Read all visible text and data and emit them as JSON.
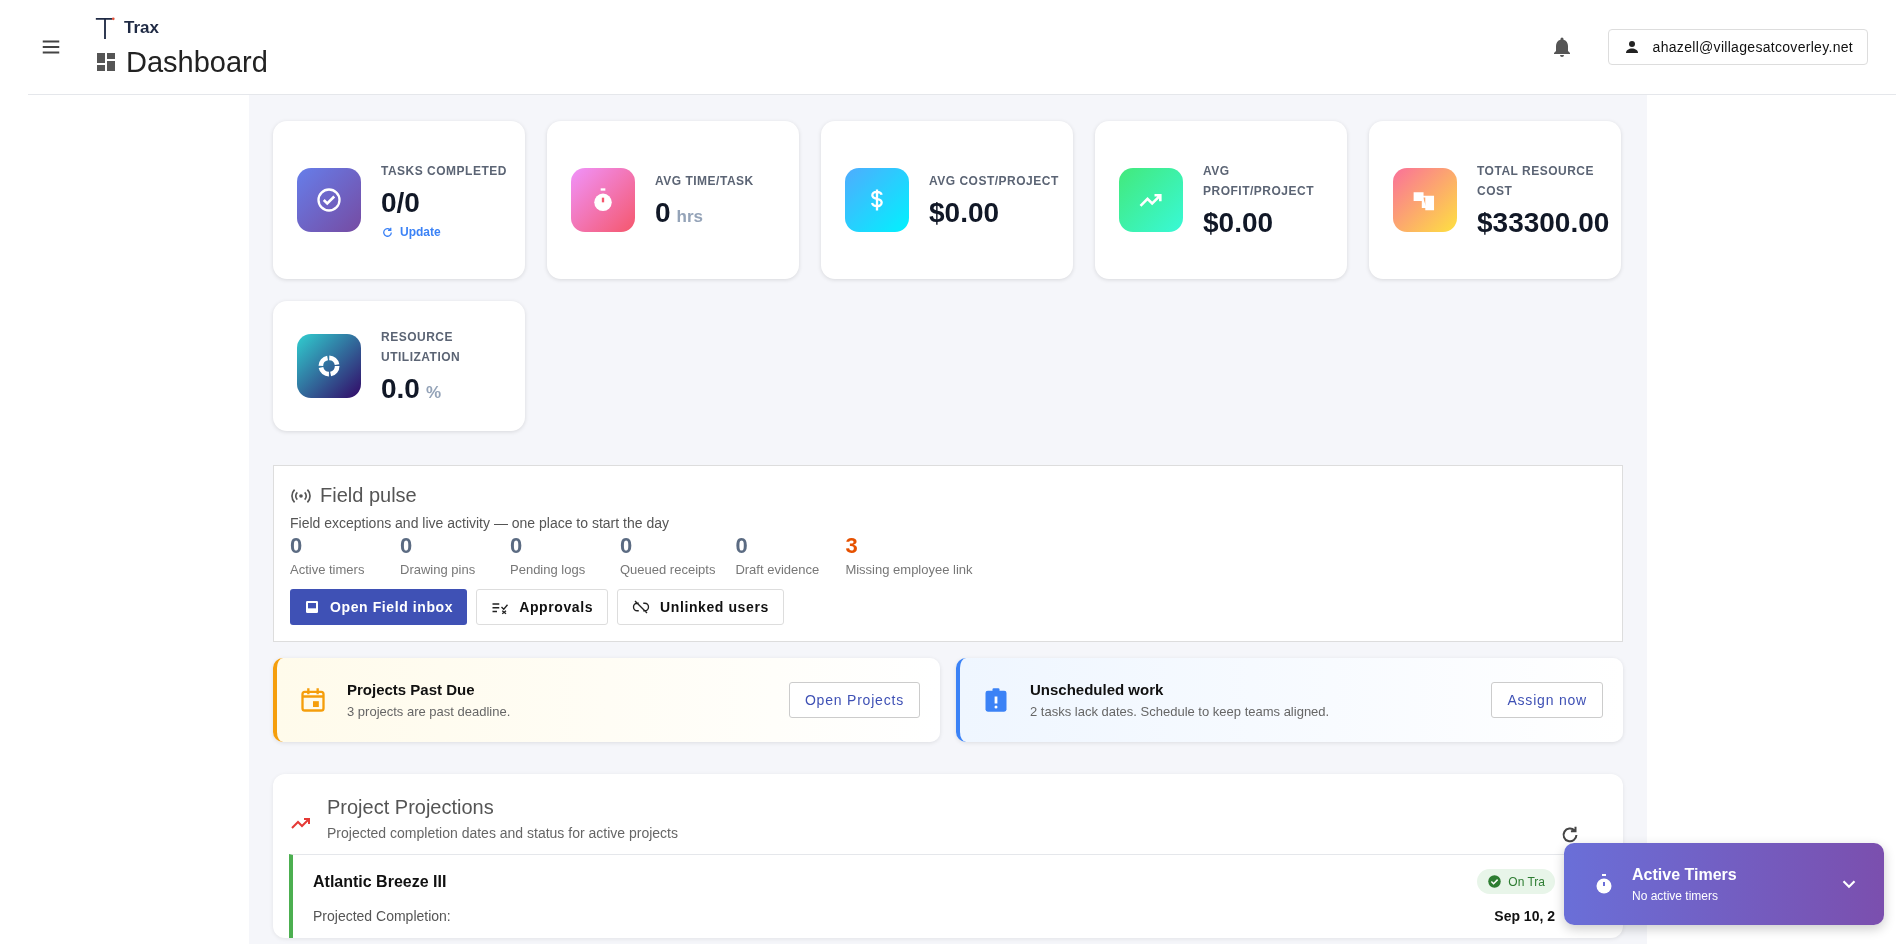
{
  "header": {
    "brand": "Trax",
    "title": "Dashboard",
    "user": "ahazell@villagesatcoverley.net"
  },
  "stat_cards": [
    {
      "kind": "check",
      "label": "TASKS COMPLETED",
      "value": "0/0",
      "action": "Update"
    },
    {
      "kind": "stopwatch",
      "label": "AVG TIME/TASK",
      "value": "0",
      "unit": "hrs"
    },
    {
      "kind": "dollar",
      "label": "AVG COST/PROJECT",
      "value": "$0.00"
    },
    {
      "kind": "trend",
      "label": "AVG PROFIT/PROJECT",
      "value": "$0.00"
    },
    {
      "kind": "hierarchy",
      "label": "TOTAL RESOURCE COST",
      "value": "$33300.00"
    },
    {
      "kind": "ring",
      "label": "RESOURCE UTILIZATION",
      "value": "0.0",
      "unit": "%"
    }
  ],
  "field_pulse": {
    "title": "Field pulse",
    "subtitle": "Field exceptions and live activity — one place to start the day",
    "stats": [
      {
        "value": "0",
        "label": "Active timers",
        "alert": false
      },
      {
        "value": "0",
        "label": "Drawing pins",
        "alert": false
      },
      {
        "value": "0",
        "label": "Pending logs",
        "alert": false
      },
      {
        "value": "0",
        "label": "Queued receipts",
        "alert": false
      },
      {
        "value": "0",
        "label": "Draft evidence",
        "alert": false
      },
      {
        "value": "3",
        "label": "Missing employee link",
        "alert": true
      }
    ],
    "buttons": [
      {
        "label": "Open Field inbox",
        "kind": "primary"
      },
      {
        "label": "Approvals",
        "kind": "outlined"
      },
      {
        "label": "Unlinked users",
        "kind": "outlined"
      }
    ]
  },
  "alerts": [
    {
      "kind": "warning",
      "title": "Projects Past Due",
      "text": "3 projects are past deadline.",
      "button": "Open Projects"
    },
    {
      "kind": "info",
      "title": "Unscheduled work",
      "text": "2 tasks lack dates. Schedule to keep teams aligned.",
      "button": "Assign now"
    }
  ],
  "projections": {
    "title": "Project Projections",
    "subtitle": "Projected completion dates and status for active projects",
    "projects": [
      {
        "name": "Atlantic Breeze III",
        "status": "On Tra",
        "fields": [
          {
            "label": "Projected Completion:",
            "value": "Sep 10, 2"
          }
        ]
      }
    ]
  },
  "timers_panel": {
    "title": "Active Timers",
    "subtitle": "No active timers"
  }
}
